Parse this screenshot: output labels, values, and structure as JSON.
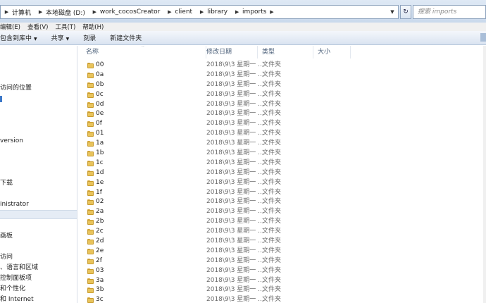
{
  "address": {
    "crumbs": [
      "计算机",
      "本地磁盘 (D:)",
      "work_cocosCreator",
      "client",
      "library",
      "imports"
    ],
    "search_placeholder": "搜索 imports"
  },
  "menu": [
    "编辑(E)",
    "查看(V)",
    "工具(T)",
    "帮助(H)"
  ],
  "commands": {
    "include_library": "包含到库中",
    "share": "共享",
    "burn": "刻录",
    "new_folder": "新建文件夹"
  },
  "nav": {
    "items": [
      "访问的位置",
      "version",
      "下载",
      "inistrator",
      "",
      "画板",
      "访问",
      "、语言和区域",
      "控制面板项",
      "和个性化",
      "和 Internet"
    ]
  },
  "columns": {
    "name": "名称",
    "date": "修改日期",
    "type": "类型",
    "size": "大小"
  },
  "files": [
    {
      "name": "00",
      "date": "2018\\9\\3 星期一 ...",
      "type": "文件夹"
    },
    {
      "name": "0a",
      "date": "2018\\9\\3 星期一 ...",
      "type": "文件夹"
    },
    {
      "name": "0b",
      "date": "2018\\9\\3 星期一 ...",
      "type": "文件夹"
    },
    {
      "name": "0c",
      "date": "2018\\9\\3 星期一 ...",
      "type": "文件夹"
    },
    {
      "name": "0d",
      "date": "2018\\9\\3 星期一 ...",
      "type": "文件夹"
    },
    {
      "name": "0e",
      "date": "2018\\9\\3 星期一 ...",
      "type": "文件夹"
    },
    {
      "name": "0f",
      "date": "2018\\9\\3 星期一 ...",
      "type": "文件夹"
    },
    {
      "name": "01",
      "date": "2018\\9\\3 星期一 ...",
      "type": "文件夹"
    },
    {
      "name": "1a",
      "date": "2018\\9\\3 星期一 ...",
      "type": "文件夹"
    },
    {
      "name": "1b",
      "date": "2018\\9\\3 星期一 ...",
      "type": "文件夹"
    },
    {
      "name": "1c",
      "date": "2018\\9\\3 星期一 ...",
      "type": "文件夹"
    },
    {
      "name": "1d",
      "date": "2018\\9\\3 星期一 ...",
      "type": "文件夹"
    },
    {
      "name": "1e",
      "date": "2018\\9\\3 星期一 ...",
      "type": "文件夹"
    },
    {
      "name": "1f",
      "date": "2018\\9\\3 星期一 ...",
      "type": "文件夹"
    },
    {
      "name": "02",
      "date": "2018\\9\\3 星期一 ...",
      "type": "文件夹"
    },
    {
      "name": "2a",
      "date": "2018\\9\\3 星期一 ...",
      "type": "文件夹"
    },
    {
      "name": "2b",
      "date": "2018\\9\\3 星期一 ...",
      "type": "文件夹"
    },
    {
      "name": "2c",
      "date": "2018\\9\\3 星期一 ...",
      "type": "文件夹"
    },
    {
      "name": "2d",
      "date": "2018\\9\\3 星期一 ...",
      "type": "文件夹"
    },
    {
      "name": "2e",
      "date": "2018\\9\\3 星期一 ...",
      "type": "文件夹"
    },
    {
      "name": "2f",
      "date": "2018\\9\\3 星期一 ...",
      "type": "文件夹"
    },
    {
      "name": "03",
      "date": "2018\\9\\3 星期一 ...",
      "type": "文件夹"
    },
    {
      "name": "3a",
      "date": "2018\\9\\3 星期一 ...",
      "type": "文件夹"
    },
    {
      "name": "3b",
      "date": "2018\\9\\3 星期一 ...",
      "type": "文件夹"
    },
    {
      "name": "3c",
      "date": "2018\\9\\3 星期一 ...",
      "type": "文件夹"
    }
  ]
}
